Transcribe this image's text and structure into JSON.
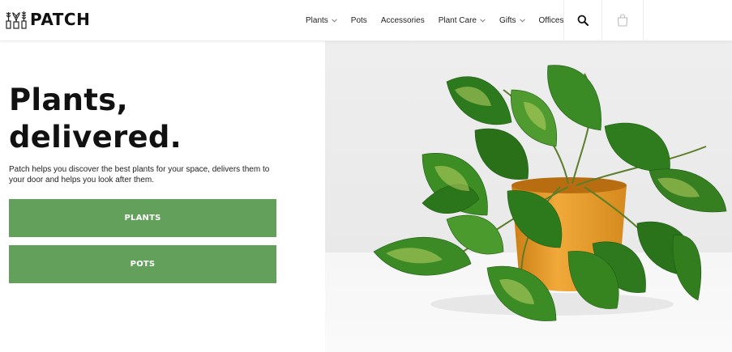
{
  "brand": {
    "name": "PATCH",
    "logo_icon": "plant-sprig-icon"
  },
  "nav": {
    "items": [
      {
        "label": "Plants",
        "has_dropdown": true
      },
      {
        "label": "Pots",
        "has_dropdown": false
      },
      {
        "label": "Accessories",
        "has_dropdown": false
      },
      {
        "label": "Plant Care",
        "has_dropdown": true
      },
      {
        "label": "Gifts",
        "has_dropdown": true
      },
      {
        "label": "Offices",
        "has_dropdown": false
      }
    ],
    "search_icon": "search-icon",
    "bag_icon": "shopping-bag-icon"
  },
  "hero": {
    "headline_line1": "Plants,",
    "headline_line2": "delivered.",
    "subtext": "Patch helps you discover the best plants for your space, delivers them to your door and helps you look after them.",
    "buttons": [
      {
        "label": "PLANTS"
      },
      {
        "label": "POTS"
      }
    ],
    "button_color": "#62a05b",
    "image_subject": "pothos-plant-in-orange-pot"
  }
}
